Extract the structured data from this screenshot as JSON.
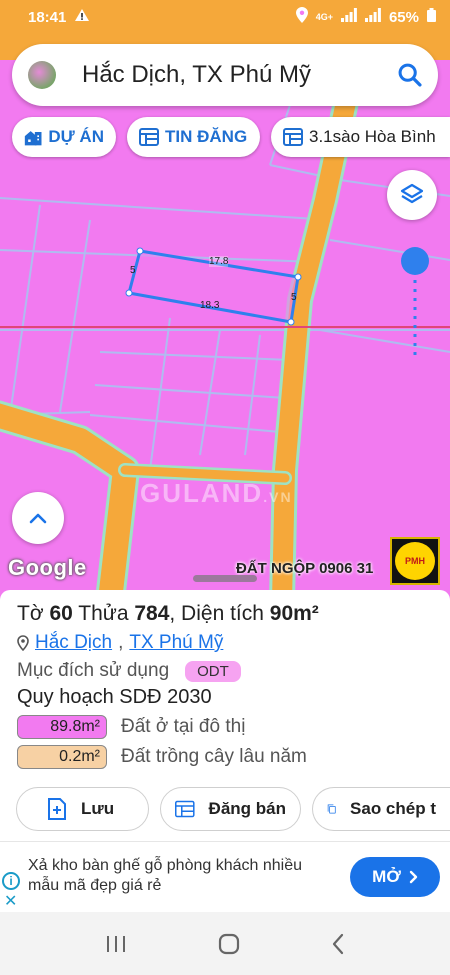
{
  "status": {
    "time": "18:41",
    "network": "4G+",
    "battery": "65%"
  },
  "search": {
    "title": "Hắc Dịch, TX Phú Mỹ"
  },
  "chips": [
    {
      "label": "DỰ ÁN",
      "icon": "building-icon"
    },
    {
      "label": "TIN ĐĂNG",
      "icon": "listing-icon"
    },
    {
      "label": "3.1sào Hòa Bình",
      "icon": "listing-icon"
    }
  ],
  "map": {
    "parcel_dims": {
      "top": "17.8",
      "bottom": "18.3",
      "left": "5",
      "right": "5"
    },
    "watermark": "GULAND",
    "watermark_suffix": ".VN",
    "google": "Google",
    "phone_tag": "ĐẤT NGỘP 0906 31",
    "logo_text": "PMH",
    "colors": {
      "residential": "#f27af0",
      "road": "#f5a83a",
      "boundary": "#2f80ed"
    }
  },
  "parcel": {
    "heading_prefix": "Tờ ",
    "sheet": "60",
    "plot_prefix": " Thửa ",
    "plot": "784",
    "area_prefix": ", Diện tích ",
    "area": "90m²",
    "ward": "Hắc Dịch",
    "separator": ", ",
    "town": "TX Phú Mỹ",
    "purpose_label": "Mục đích sử dụng",
    "purpose_code": "ODT",
    "plan_title": "Quy hoạch SDĐ 2030",
    "land_uses": [
      {
        "value": "89.8m²",
        "label": "Đất ở tại đô thị",
        "color": "#f27af0"
      },
      {
        "value": "0.2m²",
        "label": "Đất trồng cây lâu năm",
        "color": "#f7d1a4"
      }
    ]
  },
  "actions": [
    {
      "label": "Lưu",
      "icon": "add-bookmark-icon"
    },
    {
      "label": "Đăng bán",
      "icon": "listing-icon"
    },
    {
      "label": "Sao chép t",
      "icon": "copy-icon"
    }
  ],
  "ad": {
    "text": "Xả kho bàn ghế gỗ phòng khách nhiều mẫu mã đẹp giá rẻ",
    "cta": "MỞ"
  }
}
